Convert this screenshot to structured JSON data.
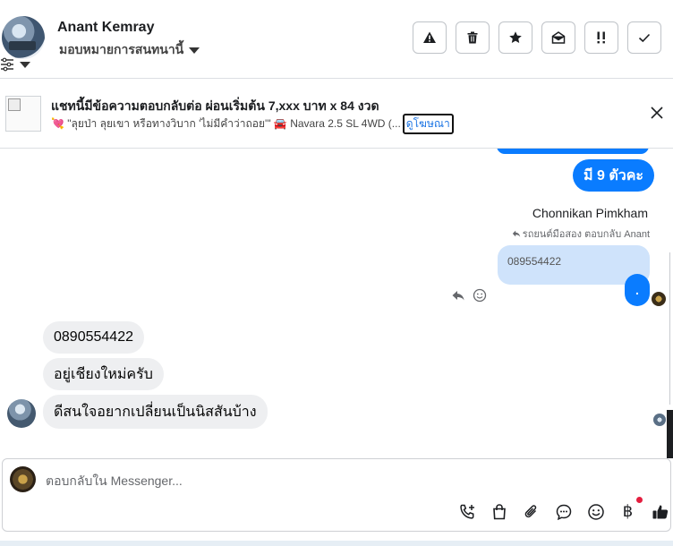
{
  "header": {
    "contact_name": "Anant Kemray",
    "assign_label": "มอบหมายการสนทนานี้"
  },
  "toolbar": {
    "icons": [
      "report-icon",
      "trash-icon",
      "star-icon",
      "mark-unread-icon",
      "priority-icon",
      "done-check-icon"
    ]
  },
  "ad": {
    "title": "แชทนี้มีข้อความตอบกลับต่อ ผ่อนเริ่มต้น 7,xxx บาท x 84 งวด",
    "subtitle": "💘 \"ลุยป่า ลุยเขา หรือทางวิบาก 'ไม่มีคำว่าถอย'\" 🚘 Navara 2.5 SL 4WD (...",
    "link_label": "ดูโฆษณา"
  },
  "messages": {
    "outgoing_1": "มี 9 ตัวคะ",
    "sender_name": "Chonnikan Pimkham",
    "reply_context": "รถยนต์มือสอง ตอบกลับ Anant",
    "quoted_text": "089554422",
    "outgoing_2": ".",
    "incoming": [
      "0890554422",
      "อยู่เชียงใหม่ครับ",
      "ดีสนใจอยากเปลี่ยนเป็นนิสสันบ้าง"
    ]
  },
  "composer": {
    "placeholder": "ตอบกลับใน Messenger...",
    "tools": [
      "call-add-icon",
      "shopping-bag-icon",
      "attachment-icon",
      "saved-reply-icon",
      "emoji-icon",
      "baht-payment-icon",
      "like-icon"
    ],
    "baht_symbol": "฿"
  },
  "colors": {
    "accent": "#0a7cff",
    "quote_bg": "#cfe3fb",
    "incoming_bg": "#eeeff1",
    "notification": "#e41e3f"
  }
}
